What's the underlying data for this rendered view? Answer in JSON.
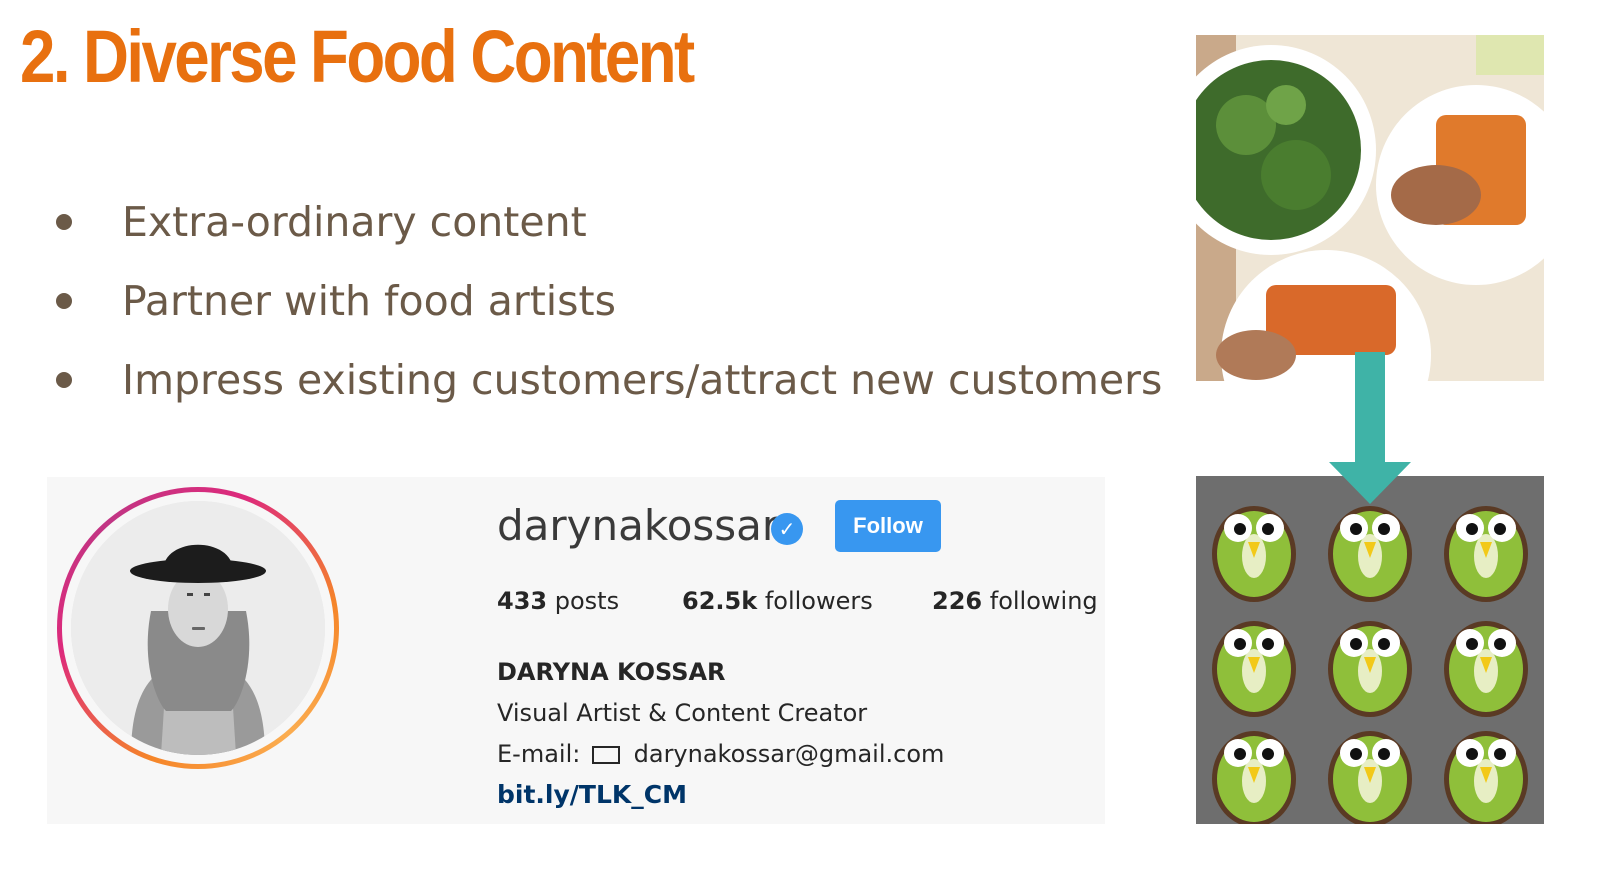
{
  "slide": {
    "title": "2. Diverse Food Content",
    "bullets": [
      "Extra-ordinary content",
      "Partner with food artists",
      "Impress existing customers/attract new customers"
    ]
  },
  "instagram": {
    "username": "darynakossar",
    "verified_icon": "verified-badge-icon",
    "follow_label": "Follow",
    "stats": [
      {
        "value": "433",
        "label": "posts"
      },
      {
        "value": "62.5k",
        "label": "followers"
      },
      {
        "value": "226",
        "label": "following"
      }
    ],
    "full_name": "DARYNA KOSSAR",
    "bio": "Visual Artist & Content Creator",
    "email_label": "E-mail:",
    "email": "darynakossar@gmail.com",
    "link": "bit.ly/TLK_CM"
  },
  "colors": {
    "title": "#e8700f",
    "bullet_text": "#6b5a48",
    "follow_button": "#3897f0",
    "arrow": "#3fb3a7"
  },
  "icons": [
    "verified-badge-icon",
    "envelope-icon",
    "down-arrow-icon"
  ]
}
